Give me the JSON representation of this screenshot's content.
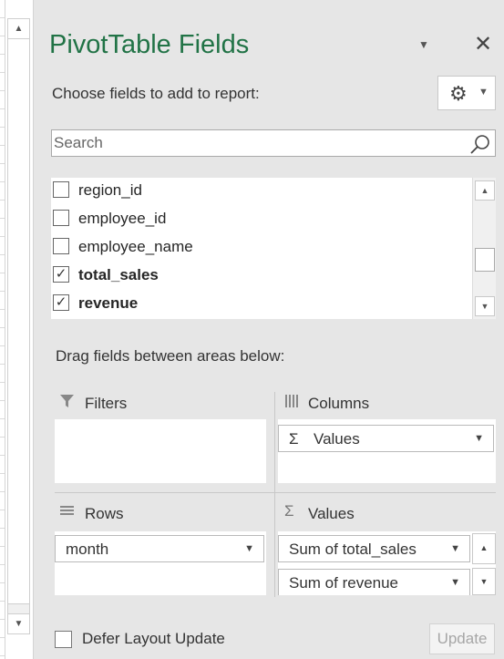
{
  "panel": {
    "title": "PivotTable Fields",
    "choose_label": "Choose fields to add to report:",
    "search_placeholder": "Search",
    "fields": [
      {
        "label": "region_id",
        "checked": false
      },
      {
        "label": "employee_id",
        "checked": false
      },
      {
        "label": "employee_name",
        "checked": false
      },
      {
        "label": "total_sales",
        "checked": true
      },
      {
        "label": "revenue",
        "checked": true
      }
    ],
    "drag_label": "Drag fields between areas below:",
    "areas": {
      "filters": {
        "title": "Filters"
      },
      "columns": {
        "title": "Columns",
        "items": [
          "Values"
        ]
      },
      "rows": {
        "title": "Rows",
        "items": [
          "month"
        ]
      },
      "values": {
        "title": "Values",
        "items": [
          "Sum of total_sales",
          "Sum of revenue"
        ]
      }
    },
    "defer_label": "Defer Layout Update",
    "update_label": "Update"
  },
  "glyphs": {
    "check": "✓",
    "sigma": "Σ",
    "gear": "⚙",
    "close": "✕",
    "caret_down": "▼",
    "caret_up": "▲"
  },
  "colors": {
    "title_green": "#217346",
    "panel_bg": "#e6e6e6"
  }
}
